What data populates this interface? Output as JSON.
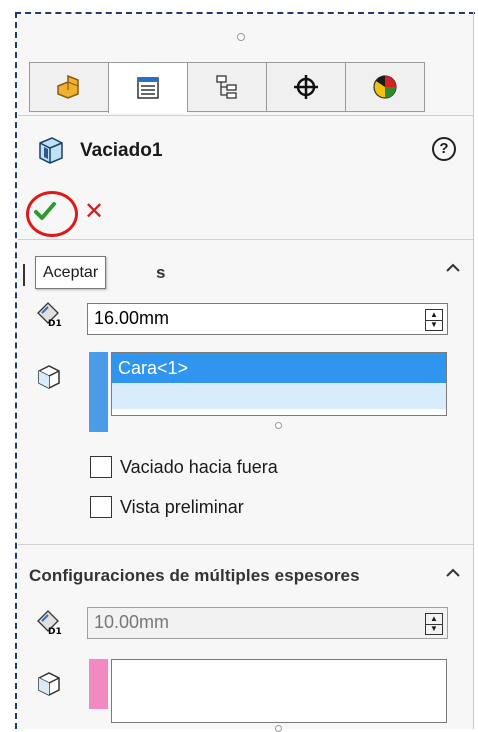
{
  "feature": {
    "title": "Vaciado1",
    "help_symbol": "?"
  },
  "tabs": [
    {
      "name": "featuremanager"
    },
    {
      "name": "propertymanager",
      "active": true
    },
    {
      "name": "configurationmanager"
    },
    {
      "name": "dimxpertmanager"
    },
    {
      "name": "display-manager"
    }
  ],
  "actions": {
    "ok_symbol": "✔",
    "cancel_symbol": "✕",
    "tooltip": "Aceptar"
  },
  "parameters": {
    "title_visible_fragment": "s",
    "thickness_value": "16.00mm",
    "faces_list": [
      "Cara<1>"
    ],
    "checkbox_outward_label": "Vaciado hacia fuera",
    "checkbox_preview_label": "Vista preliminar"
  },
  "multi_thickness": {
    "title": "Configuraciones de múltiples espesores",
    "thickness_value": "10.00mm"
  },
  "colors": {
    "list_accent": "#4a9be8",
    "multi_list_accent": "#f08ac0",
    "highlight_circle": "#e01818",
    "selection": "#2f95ee"
  }
}
